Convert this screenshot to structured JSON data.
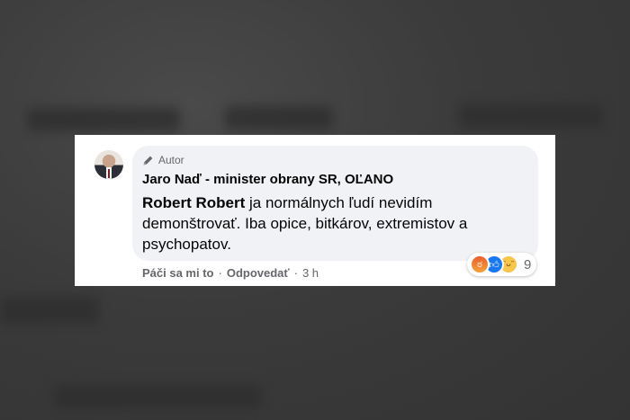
{
  "comment": {
    "badge_label": "Autor",
    "author_name": "Jaro Naď - minister obrany SR, OĽANO",
    "mention": "Robert Robert",
    "body": " ja normálnych ľudí nevidím demonštrovať. Iba opice, bitkárov, extremistov a psychopatov."
  },
  "actions": {
    "like_label": "Páči sa mi to",
    "separator": "·",
    "reply_label": "Odpovedať",
    "time": "3 h"
  },
  "reactions": {
    "icons": [
      "angry-icon",
      "like-icon",
      "haha-icon"
    ],
    "count": "9"
  },
  "colors": {
    "bubble": "#f0f2f5",
    "muted": "#65676b",
    "like": "#1877f2"
  }
}
